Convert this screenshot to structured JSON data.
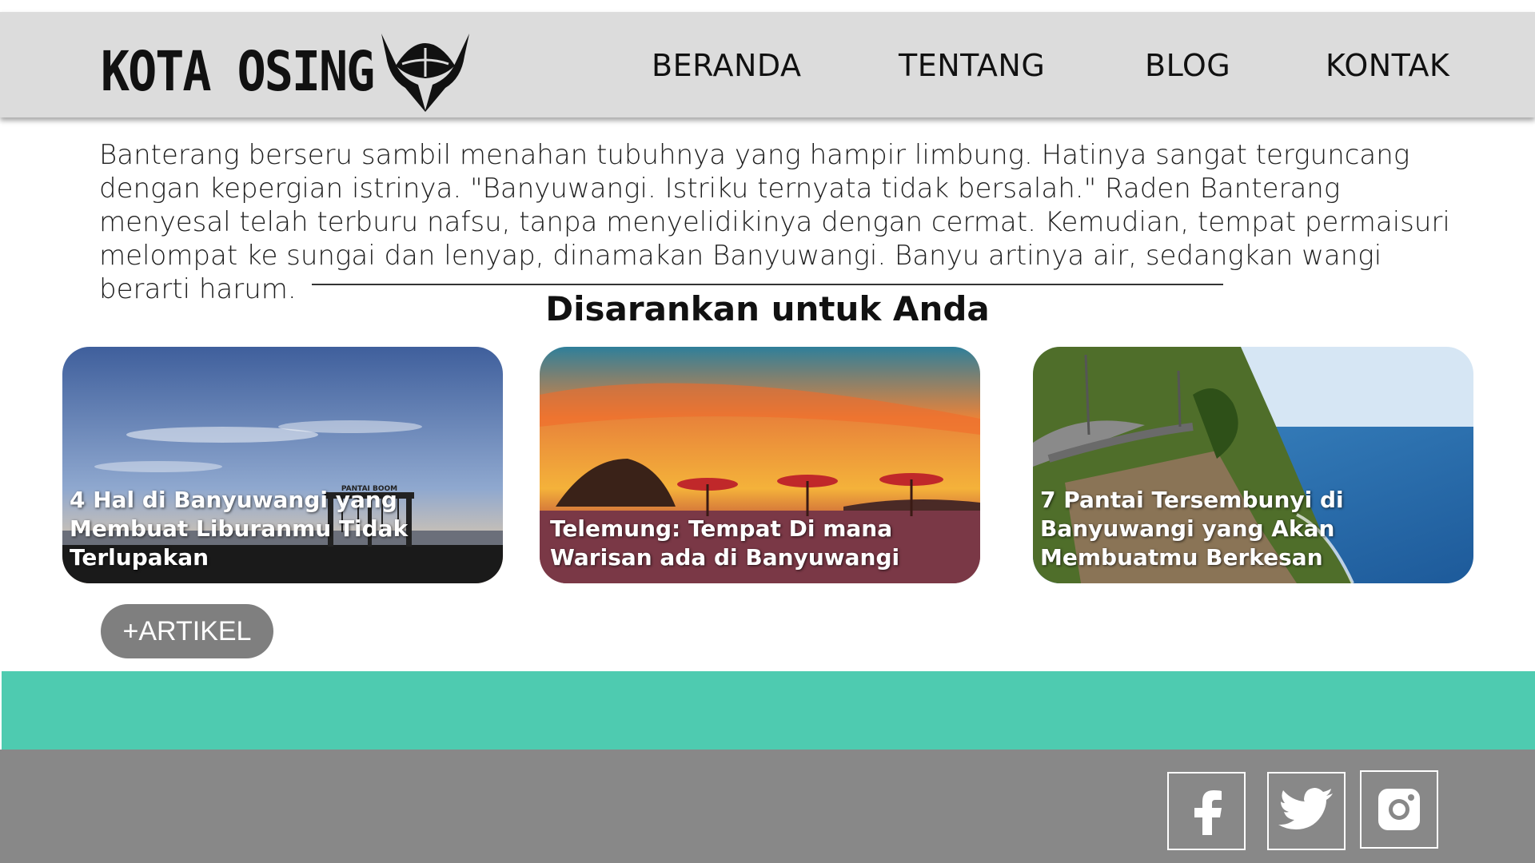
{
  "brand": {
    "name": "KOTA OSING"
  },
  "nav": {
    "items": [
      {
        "label": "BERANDA"
      },
      {
        "label": "TENTANG"
      },
      {
        "label": "BLOG"
      },
      {
        "label": "KONTAK"
      }
    ]
  },
  "story": {
    "text": "Banterang berseru sambil menahan tubuhnya yang hampir limbung. Hatinya sangat terguncang dengan kepergian istrinya. \"Banyuwangi. Istriku ternyata tidak bersalah.\" Raden Banterang menyesal telah terburu nafsu, tanpa menyelidikinya dengan cermat. Kemudian, tempat permaisuri melompat ke sungai dan lenyap, dinamakan Banyuwangi. Banyu artinya air, sedangkan wangi berarti harum."
  },
  "recommended": {
    "title": "Disarankan untuk Anda",
    "cards": [
      {
        "caption": "4 Hal di Banyuwangi yang Membuat Liburanmu Tidak Terlupakan",
        "sign": "PANTAI BOOM"
      },
      {
        "caption": "Telemung: Tempat Di mana Warisan ada di Banyuwangi"
      },
      {
        "caption": "7 Pantai Tersembunyi di Banyuwangi yang Akan Membuatmu Berkesan"
      }
    ]
  },
  "more_button": {
    "label": "+ARTIKEL"
  },
  "footer": {
    "social": [
      {
        "icon": "facebook-icon"
      },
      {
        "icon": "twitter-icon"
      },
      {
        "icon": "instagram-icon"
      }
    ]
  },
  "colors": {
    "navbar_bg": "#dcdcdc",
    "teal_band": "#4ecbb0",
    "footer_bg": "#888888",
    "button_bg": "#7f7f7f"
  }
}
